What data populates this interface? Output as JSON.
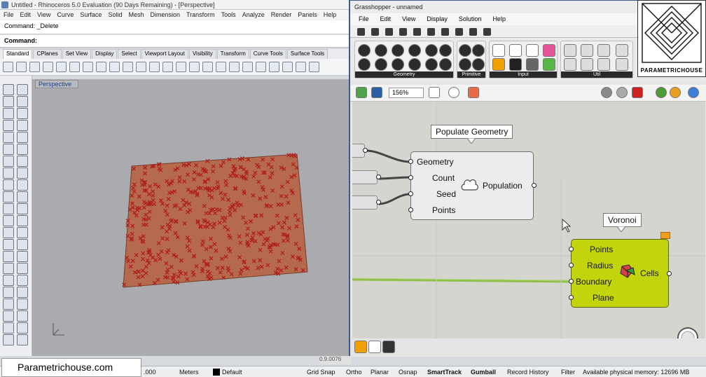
{
  "rhino": {
    "title": "Untitled - Rhinoceros 5.0 Evaluation (90 Days Remaining) - [Perspective]",
    "menu": [
      "File",
      "Edit",
      "View",
      "Curve",
      "Surface",
      "Solid",
      "Mesh",
      "Dimension",
      "Transform",
      "Tools",
      "Analyze",
      "Render",
      "Panels",
      "Help"
    ],
    "command_history": "Command: _Delete",
    "command_prompt": "Command:",
    "tabs": [
      "Standard",
      "CPlanes",
      "Set View",
      "Display",
      "Select",
      "Viewport Layout",
      "Visibility",
      "Transform",
      "Curve Tools",
      "Surface Tools"
    ],
    "viewport_label": "Perspective"
  },
  "status": {
    "coord_tail": ".000",
    "units": "Meters",
    "layer": "Default",
    "grid_snap": "Grid Snap",
    "ortho": "Ortho",
    "planar": "Planar",
    "osnap": "Osnap",
    "smarttrack": "SmartTrack",
    "gumball": "Gumball",
    "record_history": "Record History",
    "filter": "Filter",
    "memory": "Available physical memory: 12696 MB"
  },
  "watermark": "Parametrichouse.com",
  "logo_text": "PARAMETRICHOUSE",
  "grasshopper": {
    "title": "Grasshopper - unnamed",
    "menu": [
      "File",
      "Edit",
      "View",
      "Display",
      "Solution",
      "Help"
    ],
    "panels": [
      "Geometry",
      "Primitive",
      "Input",
      "Util"
    ],
    "zoom": "156%",
    "version": "0.9.0076"
  },
  "components": {
    "populate": {
      "label": "Populate Geometry",
      "inputs": [
        "Geometry",
        "Count",
        "Seed",
        "Points"
      ],
      "output": "Population"
    },
    "voronoi": {
      "label": "Voronoi",
      "inputs": [
        "Points",
        "Radius",
        "Boundary",
        "Plane"
      ],
      "output": "Cells"
    }
  },
  "colors": {
    "voronoi_fill": "#c4d40c",
    "surface_fill": "#b5694d",
    "points": "#b11e1e",
    "wire": "#8fc04a"
  }
}
